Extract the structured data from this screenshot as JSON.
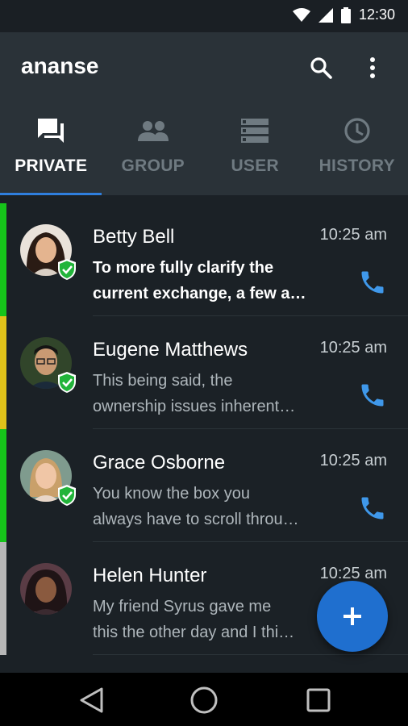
{
  "status": {
    "time": "12:30"
  },
  "app": {
    "title": "ananse"
  },
  "tabs": [
    {
      "label": "PRIVATE",
      "icon": "chat-icon",
      "active": true
    },
    {
      "label": "GROUP",
      "icon": "people-icon",
      "active": false
    },
    {
      "label": "USER",
      "icon": "user-list-icon",
      "active": false
    },
    {
      "label": "HISTORY",
      "icon": "clock-icon",
      "active": false
    }
  ],
  "conversations": [
    {
      "name": "Betty Bell",
      "time": "10:25 am",
      "preview": [
        "To more fully clarify the",
        "current exchange, a few a…"
      ],
      "unread": true,
      "status_color": "#16c41a",
      "verified": true,
      "call_icon": "phone-icon"
    },
    {
      "name": "Eugene Matthews",
      "time": "10:25 am",
      "preview": [
        "This being said, the",
        "ownership issues inherent…"
      ],
      "unread": false,
      "status_color": "#e0c21a",
      "verified": true,
      "call_icon": "phone-icon"
    },
    {
      "name": "Grace Osborne",
      "time": "10:25 am",
      "preview": [
        "You know the box you",
        "always have to scroll throu…"
      ],
      "unread": false,
      "status_color": "#16c41a",
      "verified": true,
      "call_icon": "phone-icon"
    },
    {
      "name": "Helen Hunter",
      "time": "10:25 am",
      "preview": [
        "My friend Syrus gave me",
        "this the other day and I thi…"
      ],
      "unread": false,
      "status_color": "#b7b7b7",
      "verified": false,
      "call_icon": "phone-icon"
    }
  ],
  "fab": {
    "icon": "plus-icon"
  },
  "colors": {
    "accent": "#2f7fde",
    "fab": "#1f6fcf",
    "appbar": "#2a3238",
    "background": "#1b2126",
    "verified": "#22b43a"
  }
}
